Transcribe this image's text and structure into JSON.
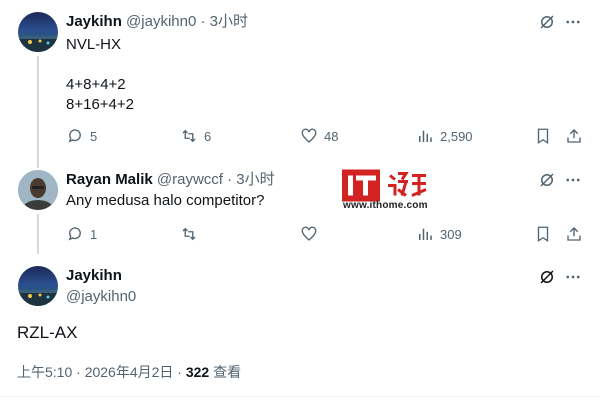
{
  "tweets": [
    {
      "name": "Jaykihn",
      "handle": "@jaykihn0",
      "time": "· 3小时",
      "lines": [
        "NVL-HX",
        "",
        "4+8+4+2",
        "8+16+4+2"
      ],
      "replies": "5",
      "retweets": "6",
      "likes": "48",
      "views": "2,590"
    },
    {
      "name": "Rayan Malik",
      "handle": "@raywccf",
      "time": "· 3小时",
      "lines": [
        "Any medusa halo competitor?"
      ],
      "replies": "1",
      "retweets": "",
      "likes": "",
      "views": "309"
    }
  ],
  "main": {
    "name": "Jaykihn",
    "handle": "@jaykihn0",
    "text": "RZL-AX",
    "time_date": "上午5:10 · 2026年4月2日 · ",
    "view_count": "322",
    "view_label": " 查看"
  },
  "watermark": {
    "logo_text": "IT之家",
    "url": "www.ithome.com"
  },
  "colors": {
    "text": "#0f1419",
    "secondary": "#536471",
    "divider": "#eff3f4",
    "watermark_red": "#d22222"
  }
}
